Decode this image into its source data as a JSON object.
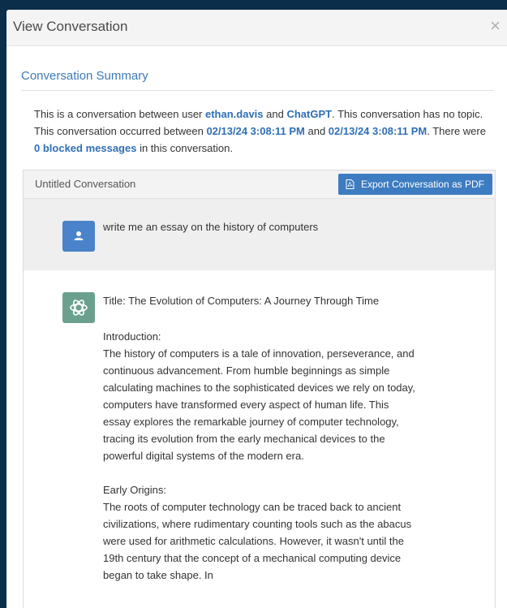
{
  "modal": {
    "title": "View Conversation",
    "close_glyph": "×"
  },
  "summary": {
    "section_title": "Conversation Summary",
    "t1": "This is a conversation between user ",
    "user": "ethan.davis",
    "t2": " and ",
    "assistant": "ChatGPT",
    "t3": ". This conversation has no topic. This conversation occurred between ",
    "start": "02/13/24 3:08:11 PM",
    "t4": " and ",
    "end": "02/13/24 3:08:11 PM",
    "t5": ". There were ",
    "blocked": "0 blocked messages",
    "t6": " in this conversation."
  },
  "conversation": {
    "title": "Untitled Conversation",
    "export_label": "Export Conversation as PDF",
    "messages": [
      {
        "role": "user",
        "icon": "user-icon",
        "text": "write me an essay on the history of computers"
      },
      {
        "role": "assistant",
        "icon": "openai-icon",
        "title": "Title: The Evolution of Computers: A Journey Through Time",
        "p1": "Introduction:",
        "p1_body": "The history of computers is a tale of innovation, perseverance, and continuous advancement. From humble beginnings as simple calculating machines to the sophisticated devices we rely on today, computers have transformed every aspect of human life. This essay explores the remarkable journey of computer technology, tracing its evolution from the early mechanical devices to the powerful digital systems of the modern era.",
        "p2": "Early Origins:",
        "p2_body": "The roots of computer technology can be traced back to ancient civilizations, where rudimentary counting tools such as the abacus were used for arithmetic calculations. However, it wasn't until the 19th century that the concept of a mechanical computing device began to take shape. In"
      }
    ]
  },
  "colors": {
    "accent": "#3d7cc0",
    "link": "#2f6fb5",
    "backdrop": "#0b2e4a",
    "ai_avatar": "#6ba08f"
  }
}
